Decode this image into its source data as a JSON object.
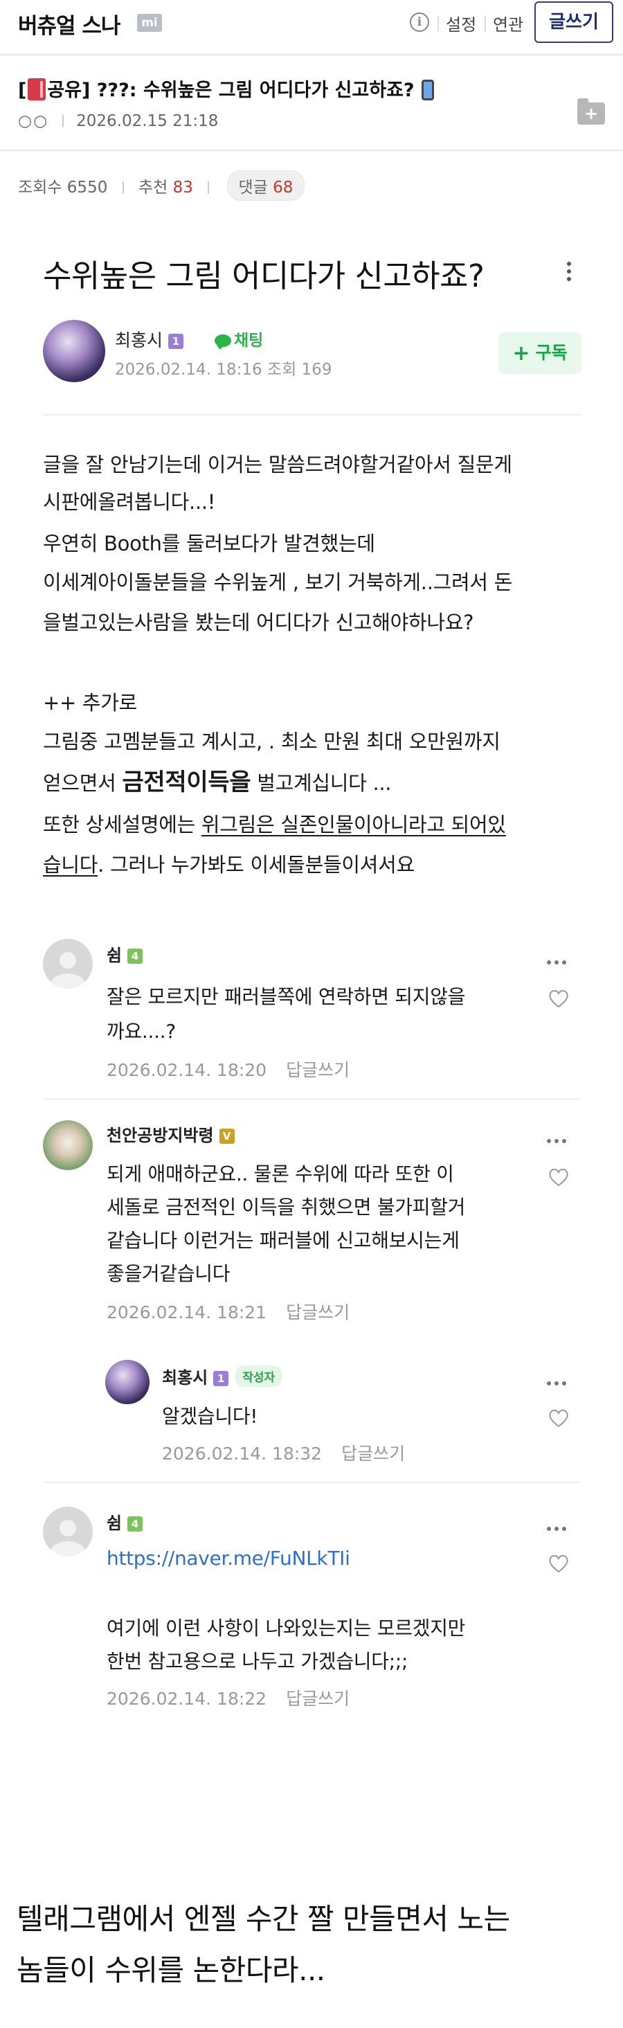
{
  "header": {
    "site_title": "버츄얼 스나",
    "site_badge": "mi",
    "settings_label": "설정",
    "related_label": "연관",
    "write_label": "글쓰기"
  },
  "share": {
    "prefix": "[",
    "tag": "공유]",
    "title": " ???: 수위높은 그림 어디다가 신고하죠?",
    "meta_dots": "○○",
    "datetime": "2026.02.15 21:18",
    "folder_symbol": "+"
  },
  "stats": {
    "views_label": "조회수",
    "views": "6550",
    "recommend_label": "추천",
    "recommend": "83",
    "comments_label": "댓글",
    "comments": "68"
  },
  "post": {
    "title": "수위높은 그림 어디다가 신고하죠?",
    "author": "최홍시",
    "author_level": "1",
    "chat_label": "채팅",
    "date": "2026.02.14. 18:16",
    "views_label": "조회",
    "views": "169",
    "subscribe_plus": "+",
    "subscribe_label": "구독",
    "body": {
      "l1": "글을 잘 안남기는데 이거는 말씀드려야할거같아서 질문게",
      "l2": "시판에올려봅니다...!",
      "l3": "우연히 Booth를 둘러보다가 발견했는데",
      "l4": "이세계아이돌분들을 수위높게 , 보기 거북하게..그려서 돈",
      "l5": "을벌고있는사람을 봤는데 어디다가 신고해야하나요?",
      "l6": "++ 추가로",
      "l7": "그림중 고멤분들고 계시고, . 최소 만원 최대 오만원까지",
      "l8a": "얻으면서 ",
      "l8b": "금전적이득을",
      "l8c": " 벌고계십니다 ...",
      "l9a": "또한 상세설명에는 ",
      "l9b": "위그림은 실존인물이아니라고 되어있",
      "l10a": "습니다",
      "l10b": ". 그러나 누가봐도 이세돌분들이셔서요"
    }
  },
  "comments": [
    {
      "name": "쉼",
      "level": "4",
      "lines": [
        "잘은 모르지만 패러블쪽에 연락하면 되지않을",
        "까요....?"
      ],
      "date": "2026.02.14. 18:20",
      "reply_label": "답글쓰기"
    },
    {
      "name": "천안공방지박령",
      "level": "V",
      "lines": [
        "되게 애매하군요.. 물론 수위에 따라 또한 이",
        "세돌로 금전적인 이득을 취했으면 불가피할거",
        "같습니다 이런거는 패러블에 신고해보시는게",
        "좋을거같습니다"
      ],
      "date": "2026.02.14. 18:21",
      "reply_label": "답글쓰기"
    },
    {
      "name": "최홍시",
      "level": "1",
      "badge": "작성자",
      "lines": [
        "알겠습니다!"
      ],
      "date": "2026.02.14. 18:32",
      "reply_label": "답글쓰기"
    },
    {
      "name": "쉼",
      "level": "4",
      "link": "https://naver.me/FuNLkTIi",
      "lines": [
        "여기에 이런 사항이 나와있는지는 모르겠지만",
        "한번 참고용으로 나두고 가겠습니다;;;"
      ],
      "date": "2026.02.14. 18:22",
      "reply_label": "답글쓰기"
    }
  ],
  "caption": {
    "l1": "텔래그램에서 엔젤 수간 짤 만들면서 노는",
    "l2": "놈들이 수위를 논한다라..."
  }
}
